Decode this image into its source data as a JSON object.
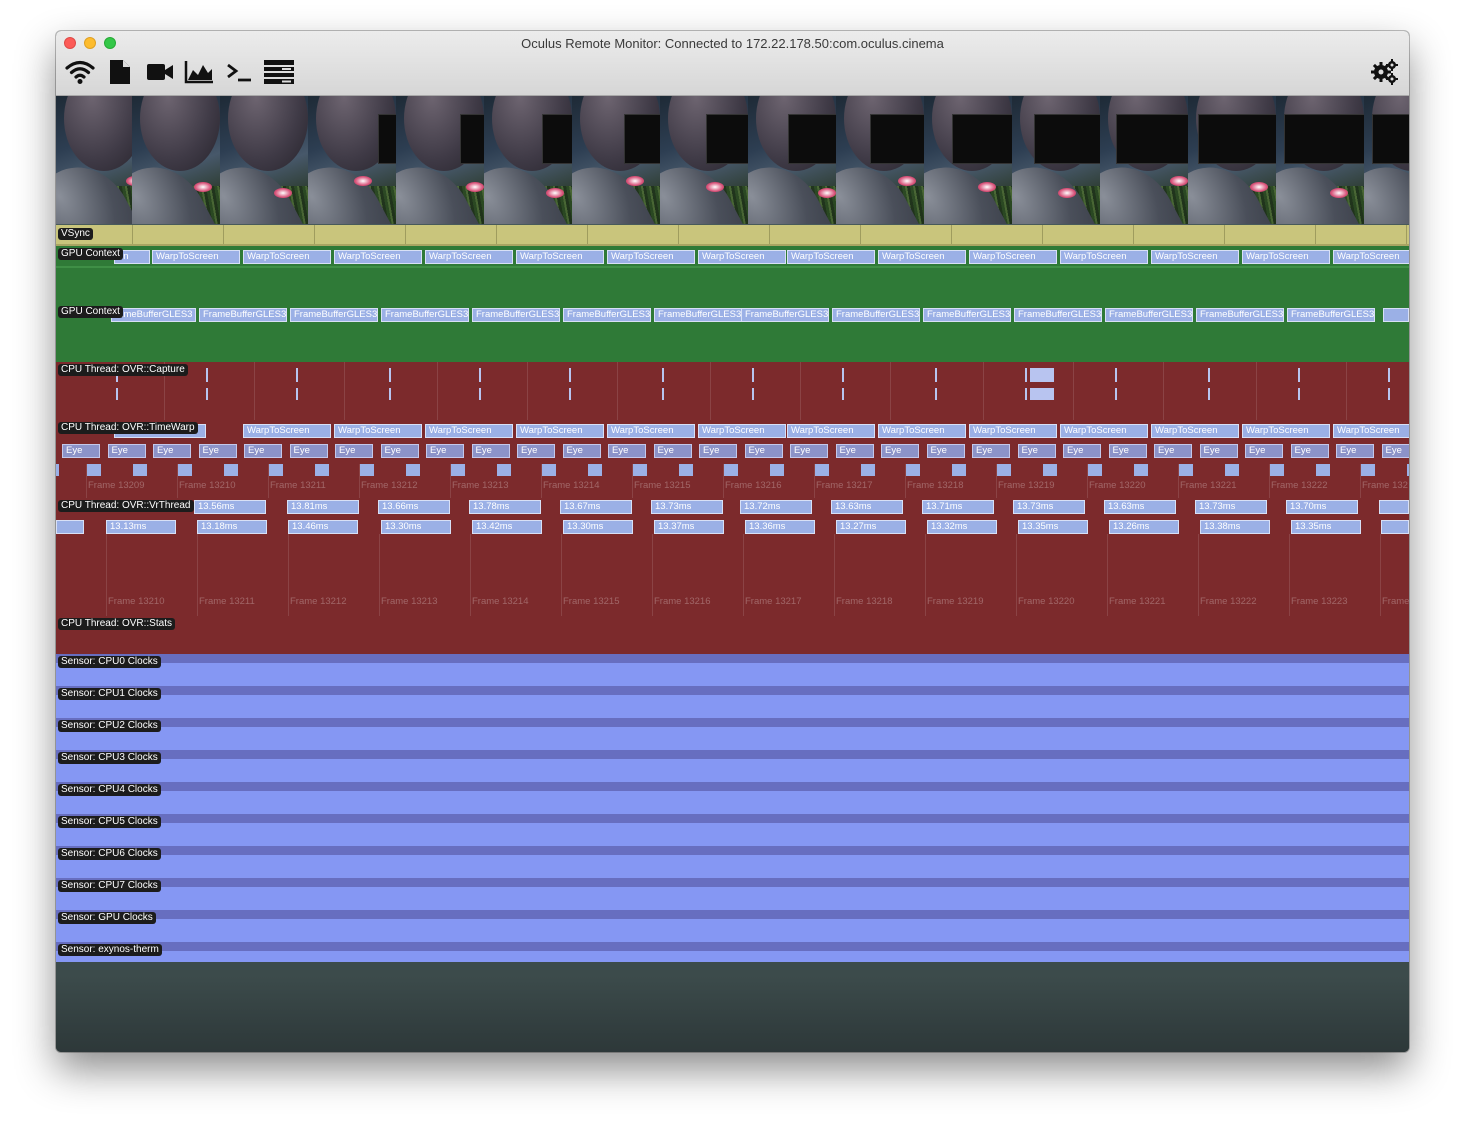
{
  "window": {
    "title": "Oculus Remote Monitor: Connected to 172.22.178.50:com.oculus.cinema"
  },
  "toolbar": {
    "icons": [
      "wifi-icon",
      "document-icon",
      "video-camera-icon",
      "area-graph-icon",
      "terminal-icon",
      "log-list-icon"
    ],
    "settings_icon": "gear-icon"
  },
  "colors": {
    "vsync": "#c9c57c",
    "gpu_context": "#2f7a37",
    "cpu_thread": "#7c2a2c",
    "sensor_fill": "#8597f3",
    "sensor_line": "#676ec0",
    "segment": "#9bb0e6"
  },
  "tracks": {
    "vsync": "VSync",
    "gpu_context_1": "GPU Context",
    "gpu_context_2": "GPU Context",
    "cpu_capture": "CPU Thread: OVR::Capture",
    "cpu_timewarp": "CPU Thread: OVR::TimeWarp",
    "cpu_vrthread": "CPU Thread: OVR::VrThread",
    "cpu_stats": "CPU Thread: OVR::Stats"
  },
  "events": {
    "warp": "WarpToScreen",
    "warp_partial": "en",
    "warp_partial_tw": "Screen",
    "framebuffer": "FrameBufferGLES3",
    "framebuffer_partial": "rameBufferGLES3",
    "eye": "Eye"
  },
  "timewarp_frames": [
    "Frame 13209",
    "Frame 13210",
    "Frame 13211",
    "Frame 13212",
    "Frame 13213",
    "Frame 13214",
    "Frame 13215",
    "Frame 13216",
    "Frame 13217",
    "Frame 13218",
    "Frame 13219",
    "Frame 13220",
    "Frame 13221",
    "Frame 13222",
    "Frame 132"
  ],
  "vrthread_frames": [
    "Frame 13210",
    "Frame 13211",
    "Frame 13212",
    "Frame 13213",
    "Frame 13214",
    "Frame 13215",
    "Frame 13216",
    "Frame 13217",
    "Frame 13218",
    "Frame 13219",
    "Frame 13220",
    "Frame 13221",
    "Frame 13222",
    "Frame 13223",
    "Frame"
  ],
  "vrthread_top_ms": [
    "13.56ms",
    "13.81ms",
    "13.66ms",
    "13.78ms",
    "13.67ms",
    "13.73ms",
    "13.72ms",
    "13.63ms",
    "13.71ms",
    "13.73ms",
    "13.63ms",
    "13.73ms",
    "13.70ms"
  ],
  "vrthread_bottom_ms": [
    "13.13ms",
    "13.18ms",
    "13.46ms",
    "13.30ms",
    "13.42ms",
    "13.30ms",
    "13.37ms",
    "13.36ms",
    "13.27ms",
    "13.32ms",
    "13.35ms",
    "13.26ms",
    "13.38ms",
    "13.35ms"
  ],
  "sensors": [
    "Sensor: CPU0 Clocks",
    "Sensor: CPU1 Clocks",
    "Sensor: CPU2 Clocks",
    "Sensor: CPU3 Clocks",
    "Sensor: CPU4 Clocks",
    "Sensor: CPU5 Clocks",
    "Sensor: CPU6 Clocks",
    "Sensor: CPU7 Clocks",
    "Sensor: GPU Clocks",
    "Sensor: exynos-therm"
  ]
}
